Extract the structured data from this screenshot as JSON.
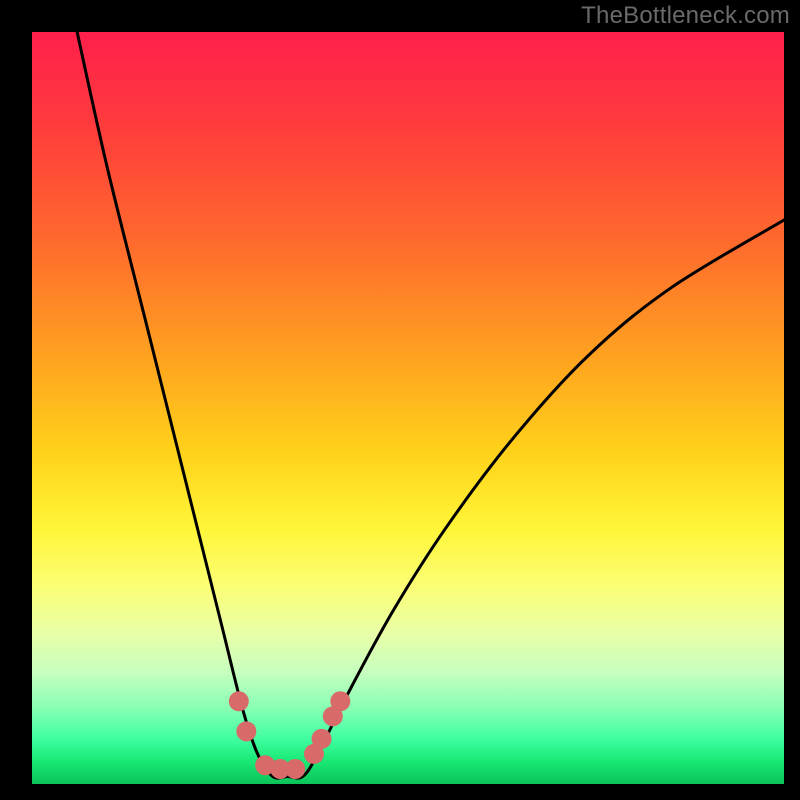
{
  "watermark": "TheBottleneck.com",
  "chart_data": {
    "type": "line",
    "title": "",
    "xlabel": "",
    "ylabel": "",
    "xlim": [
      0,
      100
    ],
    "ylim": [
      0,
      100
    ],
    "series": [
      {
        "name": "bottleneck-curve",
        "x": [
          6,
          10,
          15,
          20,
          25,
          28,
          30,
          32,
          34,
          36,
          38,
          42,
          48,
          55,
          64,
          74,
          85,
          100
        ],
        "values": [
          100,
          82,
          62,
          42,
          22,
          10,
          4,
          1,
          1,
          1,
          4,
          12,
          23,
          34,
          46,
          57,
          66,
          75
        ]
      }
    ],
    "optimal_markers": {
      "name": "optimal-range-dots",
      "color": "#d86a6a",
      "points": [
        {
          "x": 27.5,
          "y": 11
        },
        {
          "x": 28.5,
          "y": 7
        },
        {
          "x": 31,
          "y": 2.5
        },
        {
          "x": 33,
          "y": 2
        },
        {
          "x": 35,
          "y": 2
        },
        {
          "x": 37.5,
          "y": 4
        },
        {
          "x": 38.5,
          "y": 6
        },
        {
          "x": 40,
          "y": 9
        },
        {
          "x": 41,
          "y": 11
        }
      ]
    },
    "gradient_stops": [
      {
        "pos": 0,
        "color": "#ff1f4b"
      },
      {
        "pos": 50,
        "color": "#ffe030"
      },
      {
        "pos": 80,
        "color": "#f0ff90"
      },
      {
        "pos": 100,
        "color": "#0cc45a"
      }
    ]
  }
}
